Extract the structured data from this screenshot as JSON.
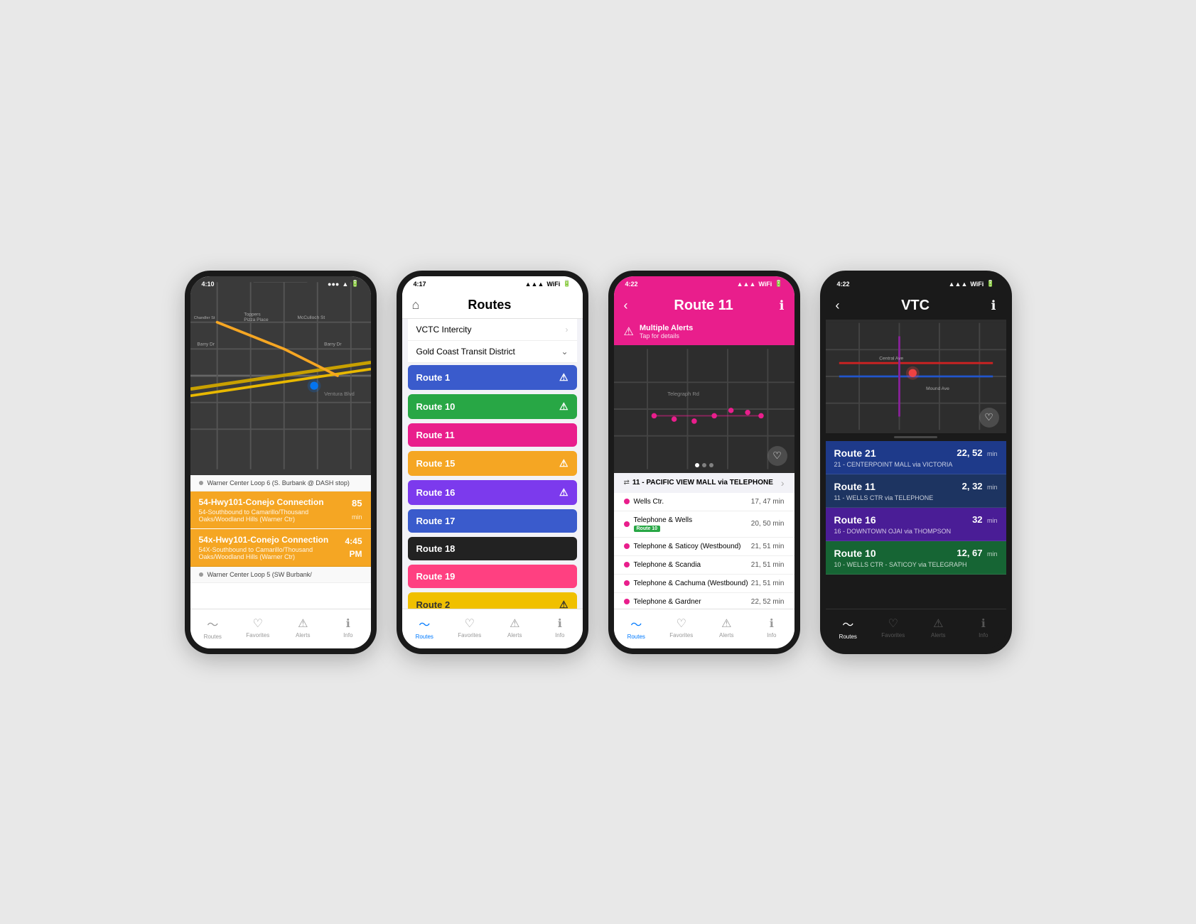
{
  "phone1": {
    "status_time": "4:10",
    "stop_label": "Warner Center Loop 6 (S. Burbank @ DASH stop)",
    "route1_name": "54-Hwy101-Conejo Connection",
    "route1_time": "85",
    "route1_unit": "min",
    "route1_sub": "54-Southbound to Camarillo/Thousand Oaks/Woodland Hills (Warner Ctr)",
    "route2_name": "54x-Hwy101-Conejo Connection",
    "route2_time": "4:45 PM",
    "route2_sub": "54X-Southbound to Camarillo/Thousand Oaks/Woodland Hills (Warner Ctr)",
    "stop2_label": "Warner Center Loop 5 (SW Burbank/",
    "nav": [
      "Routes",
      "Favorites",
      "Alerts",
      "Info"
    ]
  },
  "phone2": {
    "status_time": "4:17",
    "title": "Routes",
    "agency1": "VCTC Intercity",
    "agency2": "Gold Coast Transit District",
    "routes": [
      {
        "label": "Route 1",
        "color": "blue",
        "warn": true
      },
      {
        "label": "Route 10",
        "color": "green",
        "warn": true
      },
      {
        "label": "Route 11",
        "color": "pink",
        "warn": false
      },
      {
        "label": "Route 15",
        "color": "orange",
        "warn": true
      },
      {
        "label": "Route 16",
        "color": "purple",
        "warn": true
      },
      {
        "label": "Route 17",
        "color": "blue",
        "warn": false
      },
      {
        "label": "Route 18",
        "color": "black",
        "warn": false
      },
      {
        "label": "Route 19",
        "color": "hot-pink",
        "warn": false
      },
      {
        "label": "Route 2",
        "color": "yellow",
        "warn": true
      }
    ],
    "nav": [
      "Routes",
      "Favorites",
      "Alerts",
      "Info"
    ]
  },
  "phone3": {
    "status_time": "4:22",
    "title": "Route 11",
    "alert_title": "Multiple Alerts",
    "alert_sub": "Tap for details",
    "route_selector": "11 - PACIFIC VIEW MALL via TELEPHONE",
    "stops": [
      {
        "name": "Wells Ctr.",
        "times": "17, 47 min"
      },
      {
        "name": "Telephone & Wells",
        "times": "20, 50 min",
        "badge": "Route 10"
      },
      {
        "name": "Telephone & Saticoy (Westbound)",
        "times": "21, 51 min"
      },
      {
        "name": "Telephone & Scandia",
        "times": "21, 51 min"
      },
      {
        "name": "Telephone & Cachuma (Westbound)",
        "times": "21, 51 min"
      },
      {
        "name": "Telephone & Gardner",
        "times": "22, 52 min"
      }
    ],
    "nav": [
      "Routes",
      "Favorites",
      "Alerts",
      "Info"
    ]
  },
  "phone4": {
    "status_time": "4:22",
    "title": "VTC",
    "routes": [
      {
        "name": "Route 21",
        "times": "22, 52",
        "sub": "21 - CENTERPOINT MALL via VICTORIA",
        "color": "blue-bg"
      },
      {
        "name": "Route 11",
        "times": "2, 32",
        "sub": "11 - WELLS CTR via TELEPHONE",
        "color": "dark-blue"
      },
      {
        "name": "Route 16",
        "times": "32",
        "sub": "16 - DOWNTOWN OJAI via THOMPSON",
        "color": "purple-bg"
      },
      {
        "name": "Route 10",
        "times": "12, 67",
        "sub": "10 - WELLS CTR - SATICOY via TELEGRAPH",
        "color": "green-bg"
      }
    ],
    "nav": [
      "Routes",
      "Favorites",
      "Alerts",
      "Info"
    ]
  }
}
